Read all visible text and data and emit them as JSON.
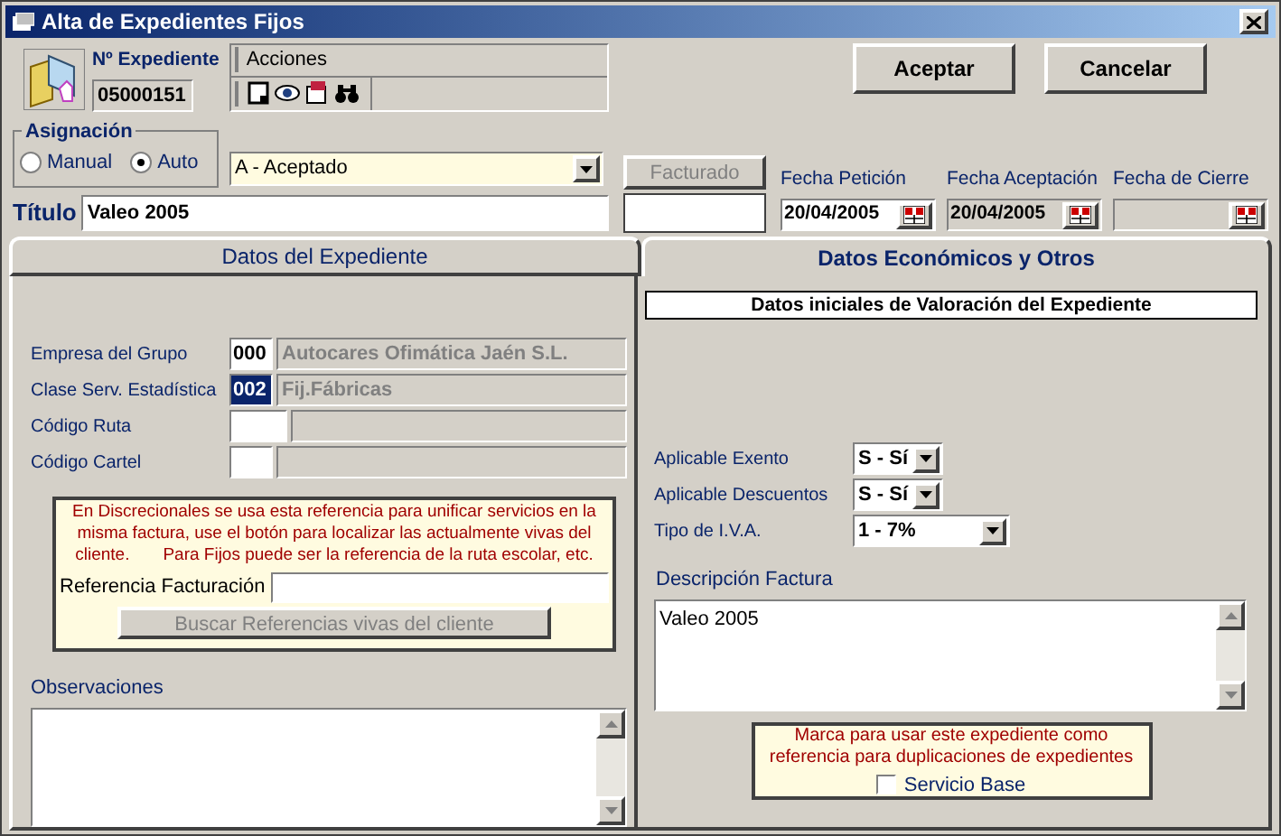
{
  "window": {
    "title": "Alta de Expedientes Fijos"
  },
  "expediente": {
    "label": "Nº Expediente",
    "value": "05000151"
  },
  "actions_toolbar": {
    "label": "Acciones"
  },
  "buttons": [
    {
      "label": "Aceptar"
    },
    {
      "label": "Cancelar"
    }
  ],
  "asignacion": {
    "label": "Asignación",
    "options": [
      {
        "label": "Manual",
        "selected": false
      },
      {
        "label": "Auto",
        "selected": true
      }
    ]
  },
  "estado": {
    "value": "A - Aceptado"
  },
  "facturado": {
    "label": "Facturado",
    "disabled": true
  },
  "titulo": {
    "label": "Título",
    "value": "Valeo 2005"
  },
  "fechas": [
    {
      "label": "Fecha Petición",
      "value": "20/04/2005",
      "disabled": false
    },
    {
      "label": "Fecha Aceptación",
      "value": "20/04/2005",
      "disabled": true
    },
    {
      "label": "Fecha de Cierre",
      "disabled": true
    }
  ],
  "tabs": [
    {
      "label": "Datos del Expediente",
      "selected": false
    },
    {
      "label": "Datos Económicos y Otros",
      "selected": true
    }
  ],
  "expediente_fields": [
    {
      "label": "Empresa del Grupo",
      "code": "000",
      "name": "Autocares Ofimática Jaén S.L.",
      "selected": false
    },
    {
      "label": "Clase Serv. Estadística",
      "code": "002",
      "name": "Fij.Fábricas",
      "selected": true
    },
    {
      "label": "Código Ruta",
      "selected": false
    },
    {
      "label": "Código Cartel",
      "selected": false
    }
  ],
  "referencia": {
    "note": "En Discrecionales se usa esta referencia para unificar servicios en la misma factura, use el botón para localizar las actualmente vivas del cliente.       Para Fijos puede ser la referencia de la ruta escolar, etc.",
    "label": "Referencia Facturación",
    "button": "Buscar Referencias vivas del cliente",
    "button_disabled": true
  },
  "observaciones": {
    "label": "Observaciones"
  },
  "valoracion": {
    "heading": "Datos iniciales de Valoración del Expediente",
    "selects": [
      {
        "label": "Aplicable Exento",
        "value": "S - Sí"
      },
      {
        "label": "Aplicable Descuentos",
        "value": "S - Sí"
      },
      {
        "label": "Tipo de I.V.A.",
        "value": "1 - 7%"
      }
    ]
  },
  "descripcion": {
    "label": "Descripción Factura",
    "value": "Valeo 2005"
  },
  "servicio_base": {
    "note": "Marca para usar este expediente como referencia para duplicaciones de expedientes",
    "label": "Servicio Base",
    "checked": false
  }
}
